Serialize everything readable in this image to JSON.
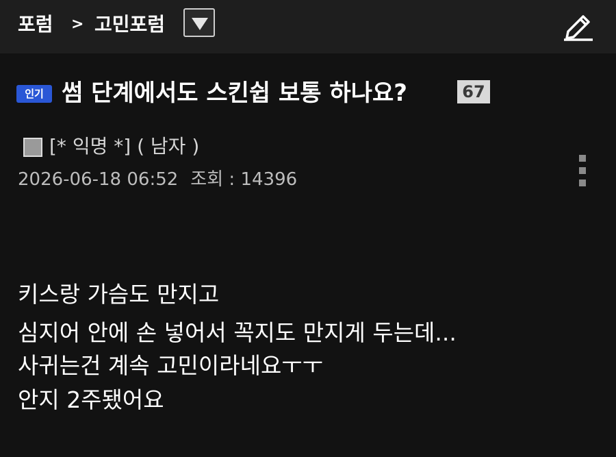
{
  "header": {
    "breadcrumb_root": "포럼",
    "breadcrumb_separator": ">",
    "breadcrumb_current": "고민포럼",
    "dropdown_icon": "triangle-down-icon",
    "write_icon": "pencil-icon"
  },
  "post": {
    "badge": "인기",
    "title": "썸 단계에서도 스킨쉽 보통 하나요?",
    "comment_count": "67",
    "author": "[* 익명 *] ( 남자 )",
    "datetime": "2026-06-18 06:52",
    "views_label": "조회 : ",
    "views": "14396",
    "more_icon": "vertical-dots-icon",
    "body": [
      "키스랑 가슴도 만지고",
      "심지어 안에 손 넣어서 꼭지도 만지게 두는데...",
      "사귀는건 계속 고민이라네요ㅜㅜ",
      "안지 2주됐어요"
    ]
  },
  "colors": {
    "background": "#121212",
    "header_bg": "#1e1e1e",
    "badge_bg": "#2a57d6",
    "comment_badge_bg": "#d9d9d9"
  }
}
